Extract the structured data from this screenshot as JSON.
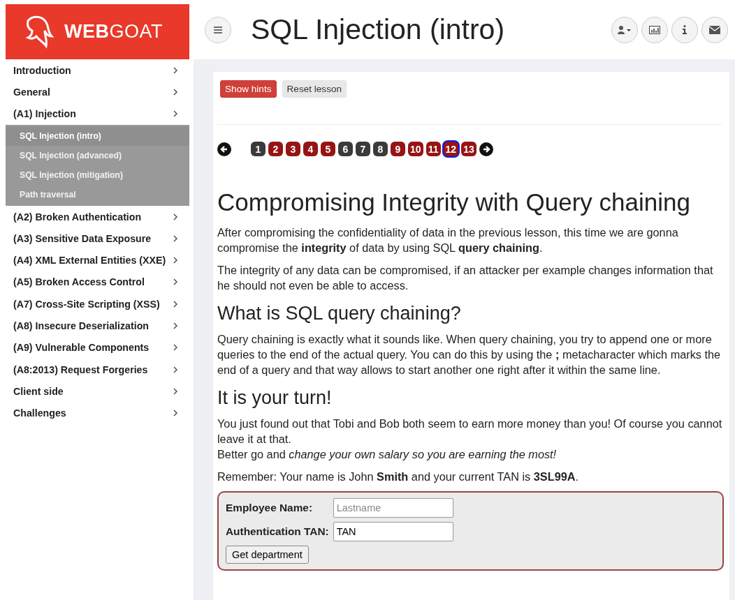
{
  "logo": {
    "bold": "WEB",
    "light": "GOAT"
  },
  "sidebar": {
    "items": [
      {
        "label": "Introduction"
      },
      {
        "label": "General"
      },
      {
        "label": "(A1) Injection",
        "children": [
          {
            "label": "SQL Injection (intro)",
            "selected": true
          },
          {
            "label": "SQL Injection (advanced)",
            "selected": false
          },
          {
            "label": "SQL Injection (mitigation)",
            "selected": false
          },
          {
            "label": "Path traversal",
            "selected": false
          }
        ]
      },
      {
        "label": "(A2) Broken Authentication"
      },
      {
        "label": "(A3) Sensitive Data Exposure"
      },
      {
        "label": "(A4) XML External Entities (XXE)"
      },
      {
        "label": "(A5) Broken Access Control"
      },
      {
        "label": "(A7) Cross-Site Scripting (XSS)"
      },
      {
        "label": "(A8) Insecure Deserialization"
      },
      {
        "label": "(A9) Vulnerable Components"
      },
      {
        "label": "(A8:2013) Request Forgeries"
      },
      {
        "label": "Client side"
      },
      {
        "label": "Challenges"
      }
    ]
  },
  "header": {
    "title": "SQL Injection (intro)"
  },
  "lesson_buttons": [
    "Show hints",
    "Reset lesson"
  ],
  "pages": [
    {
      "label": "1",
      "kind": "info",
      "selected": false
    },
    {
      "label": "2",
      "kind": "assignment",
      "selected": false
    },
    {
      "label": "3",
      "kind": "assignment",
      "selected": false
    },
    {
      "label": "4",
      "kind": "assignment",
      "selected": false
    },
    {
      "label": "5",
      "kind": "assignment",
      "selected": false
    },
    {
      "label": "6",
      "kind": "info",
      "selected": false
    },
    {
      "label": "7",
      "kind": "info",
      "selected": false
    },
    {
      "label": "8",
      "kind": "info",
      "selected": false
    },
    {
      "label": "9",
      "kind": "assignment",
      "selected": false
    },
    {
      "label": "10",
      "kind": "assignment",
      "selected": false
    },
    {
      "label": "11",
      "kind": "assignment",
      "selected": false
    },
    {
      "label": "12",
      "kind": "assignment",
      "selected": true
    },
    {
      "label": "13",
      "kind": "assignment",
      "selected": false
    }
  ],
  "content": [
    {
      "kind": "h1",
      "text": "Compromising Integrity with Query chaining"
    },
    {
      "kind": "p",
      "text": "After compromising the confidentiality of data in the previous lesson, this time we are gonna compromise the **integrity** of data by using SQL **query chaining**."
    },
    {
      "kind": "p",
      "text": "The integrity of any data can be compromised, if an attacker per example changes information that he should not even be able to access."
    },
    {
      "kind": "h2",
      "text": "What is SQL query chaining?"
    },
    {
      "kind": "p",
      "text": "Query chaining is exactly what it sounds like. When query chaining, you try to append one or more queries to the end of the actual query. You can do this by using the **;** metacharacter which marks the end of a query and that way allows to start another one right after it within the same line."
    },
    {
      "kind": "h2",
      "text": "It is your turn!"
    },
    {
      "kind": "p2",
      "lines": [
        "You just found out that Tobi and Bob both seem to earn more money than you! Of course you cannot leave it at that.",
        "Better go and *change your own salary so you are earning the most!*"
      ]
    },
    {
      "kind": "p",
      "text": "Remember: Your name is John **Smith** and your current TAN is **3SL99A**."
    }
  ],
  "form": {
    "fields": [
      {
        "label": "Employee Name:",
        "placeholder": "Lastname"
      },
      {
        "label": "Authentication TAN:",
        "value": "TAN"
      }
    ],
    "button": "Get department"
  }
}
